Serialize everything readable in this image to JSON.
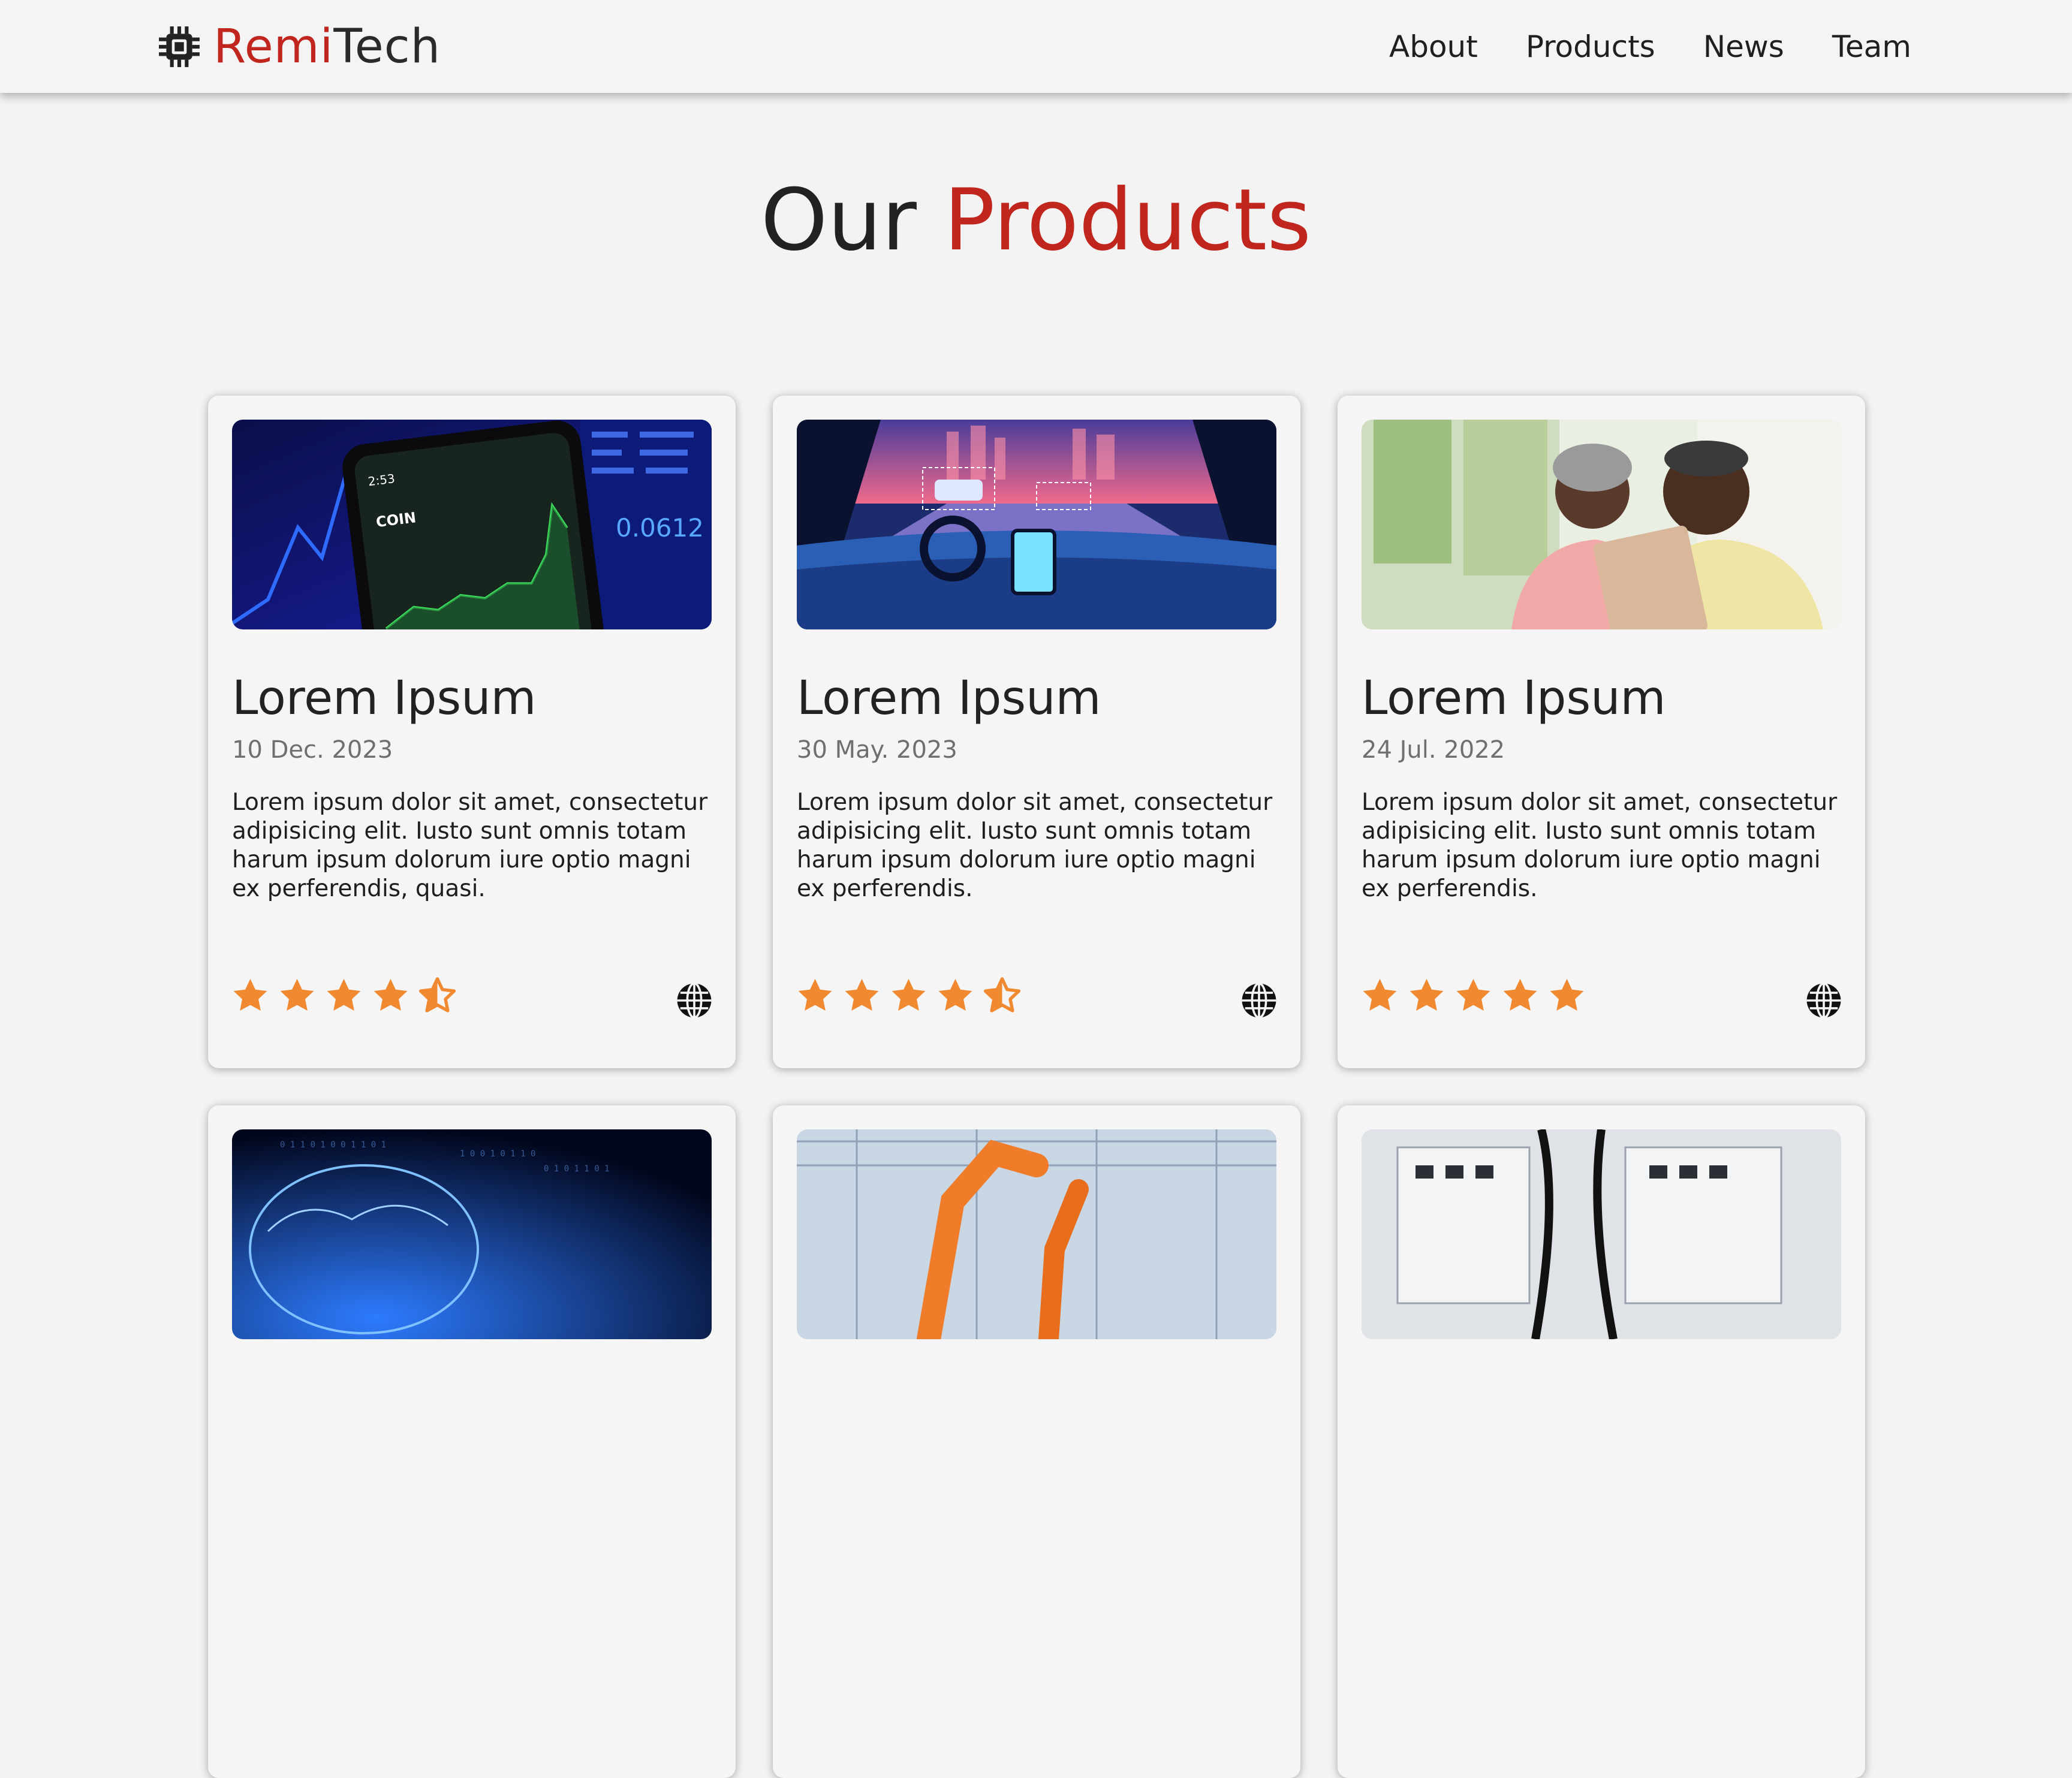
{
  "brand": {
    "part1": "Remi",
    "part2": "Tech"
  },
  "nav": [
    "About",
    "Products",
    "News",
    "Team"
  ],
  "heading": {
    "part1": "Our",
    "part2": "Products"
  },
  "colors": {
    "accent": "#c0261d",
    "star": "#f0892f",
    "background": "#f3f3f3"
  },
  "cards": [
    {
      "title": "Lorem Ipsum",
      "date": "10 Dec. 2023",
      "text": "Lorem ipsum dolor sit amet, consectetur adipisicing elit. Iusto sunt omnis totam harum ipsum dolorum iure optio magni ex perferendis, quasi.",
      "rating": 4.5,
      "image": "stock-chart-phone-image"
    },
    {
      "title": "Lorem Ipsum",
      "date": "30 May. 2023",
      "text": "Lorem ipsum dolor sit amet, consectetur adipisicing elit. Iusto sunt omnis totam harum ipsum dolorum iure optio magni ex perferendis.",
      "rating": 4.5,
      "image": "autonomous-car-cockpit-image"
    },
    {
      "title": "Lorem Ipsum",
      "date": "24 Jul. 2022",
      "text": "Lorem ipsum dolor sit amet, consectetur adipisicing elit. Iusto sunt omnis totam harum ipsum dolorum iure optio magni ex perferendis.",
      "rating": 5,
      "image": "elderly-couple-tablet-image"
    },
    {
      "image": "digital-brain-image"
    },
    {
      "image": "robotic-arm-factory-image"
    },
    {
      "image": "server-cables-image"
    }
  ],
  "icons": {
    "logo": "chip-icon",
    "link": "globe-icon",
    "rating": "star-icon"
  }
}
